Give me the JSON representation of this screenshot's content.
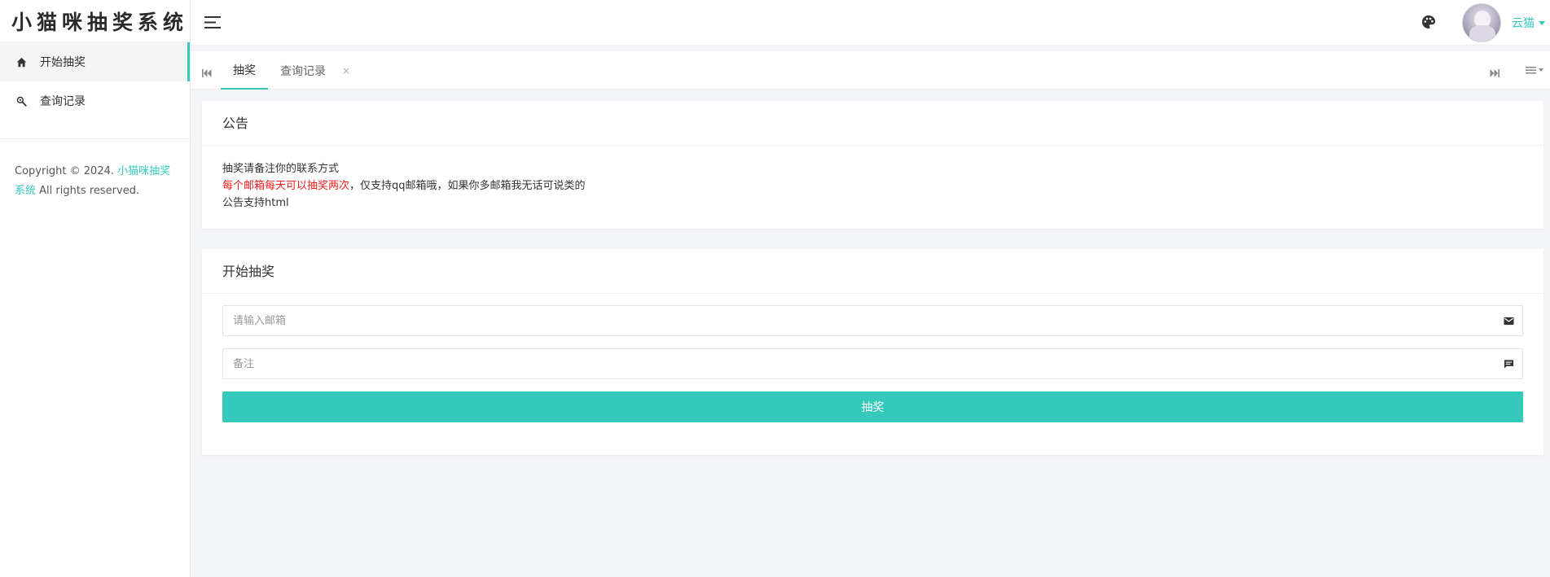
{
  "app": {
    "logo_text": "小猫咪抽奖系统"
  },
  "sidebar": {
    "items": [
      {
        "label": "开始抽奖",
        "icon": "home-icon"
      },
      {
        "label": "查询记录",
        "icon": "search-key-icon"
      }
    ],
    "copyright_prefix": "Copyright © 2024.",
    "copyright_link": "小猫咪抽奖系统",
    "copyright_suffix": "All rights reserved."
  },
  "header": {
    "user_name": "云猫"
  },
  "tabs": [
    {
      "label": "抽奖"
    },
    {
      "label": "查询记录"
    }
  ],
  "tab_close_glyph": "×",
  "notice": {
    "title": "公告",
    "line1": "抽奖请备注你的联系方式",
    "line2_red": "每个邮箱每天可以抽奖两次",
    "line2_rest": "，仅支持qq邮箱哦，如果你多邮箱我无话可说类的",
    "line3": "公告支持html"
  },
  "lottery": {
    "title": "开始抽奖",
    "email_placeholder": "请输入邮箱",
    "email_value": "",
    "remark_placeholder": "备注",
    "remark_value": "",
    "submit_label": "抽奖"
  },
  "colors": {
    "accent": "#34c9bb",
    "notice_red": "#ee1c1c"
  }
}
